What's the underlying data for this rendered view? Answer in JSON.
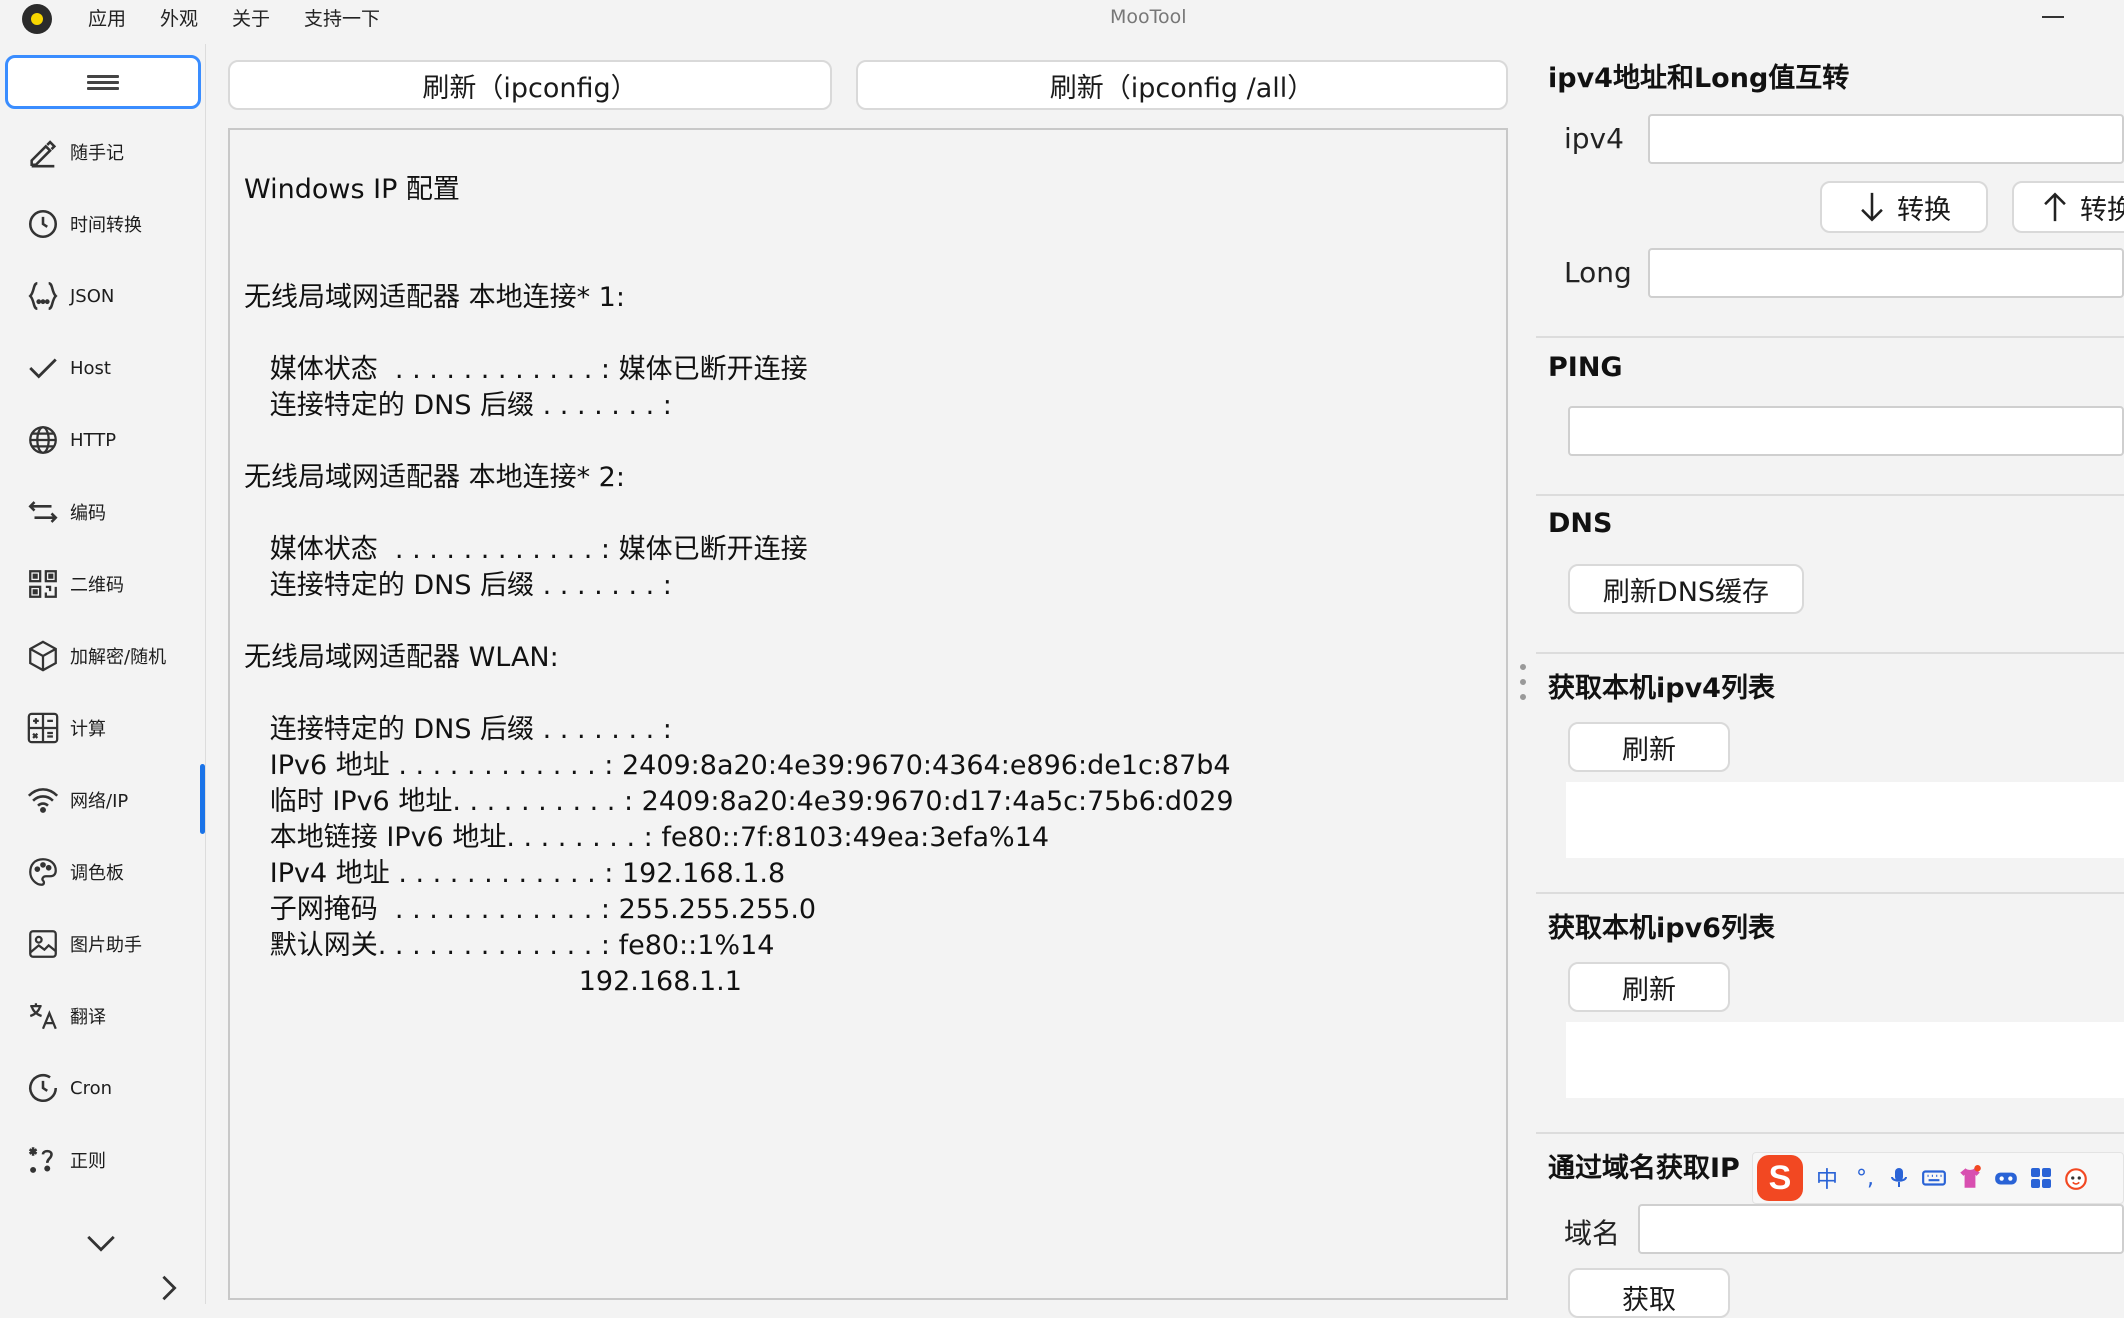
{
  "window": {
    "title": "MooTool",
    "menu": [
      "应用",
      "外观",
      "关于",
      "支持一下"
    ]
  },
  "sidebar": {
    "items": [
      {
        "label": "随手记",
        "icon": "pencil-icon"
      },
      {
        "label": "时间转换",
        "icon": "clock-icon"
      },
      {
        "label": "JSON",
        "icon": "braces-icon"
      },
      {
        "label": "Host",
        "icon": "checkmark-icon"
      },
      {
        "label": "HTTP",
        "icon": "globe-icon"
      },
      {
        "label": "编码",
        "icon": "swap-arrows-icon"
      },
      {
        "label": "二维码",
        "icon": "qrcode-icon"
      },
      {
        "label": "加解密/随机",
        "icon": "cube-icon"
      },
      {
        "label": "计算",
        "icon": "calculator-icon"
      },
      {
        "label": "网络/IP",
        "icon": "wifi-icon"
      },
      {
        "label": "调色板",
        "icon": "palette-icon"
      },
      {
        "label": "图片助手",
        "icon": "image-icon"
      },
      {
        "label": "翻译",
        "icon": "translate-icon"
      },
      {
        "label": "Cron",
        "icon": "cron-clock-icon"
      },
      {
        "label": "正则",
        "icon": "regex-icon"
      }
    ],
    "active": "网络/IP"
  },
  "toolbar": {
    "refresh_ipconfig": "刷新（ipconfig）",
    "refresh_ipconfig_all": "刷新（ipconfig /all）"
  },
  "output": {
    "text": "Windows IP 配置\n\n\n无线局域网适配器 本地连接* 1:\n\n   媒体状态  . . . . . . . . . . . . : 媒体已断开连接\n   连接特定的 DNS 后缀 . . . . . . . :\n\n无线局域网适配器 本地连接* 2:\n\n   媒体状态  . . . . . . . . . . . . : 媒体已断开连接\n   连接特定的 DNS 后缀 . . . . . . . :\n\n无线局域网适配器 WLAN:\n\n   连接特定的 DNS 后缀 . . . . . . . :\n   IPv6 地址 . . . . . . . . . . . . : 2409:8a20:4e39:9670:4364:e896:de1c:87b4\n   临时 IPv6 地址. . . . . . . . . . : 2409:8a20:4e39:9670:d17:4a5c:75b6:d029\n   本地链接 IPv6 地址. . . . . . . . : fe80::7f:8103:49ea:3efa%14\n   IPv4 地址 . . . . . . . . . . . . : 192.168.1.8\n   子网掩码  . . . . . . . . . . . . : 255.255.255.0\n   默认网关. . . . . . . . . . . . . : fe80::1%14\n                                       192.168.1.1"
  },
  "ipv4_long": {
    "title": "ipv4地址和Long值互转",
    "ipv4_label": "ipv4",
    "ipv4_value": "",
    "convert_down": "转换",
    "convert_up": "转换",
    "long_label": "Long",
    "long_value": ""
  },
  "ping": {
    "title": "PING",
    "value": ""
  },
  "dns": {
    "title": "DNS",
    "flush_button": "刷新DNS缓存"
  },
  "ipv4_list": {
    "title": "获取本机ipv4列表",
    "refresh_button": "刷新"
  },
  "ipv6_list": {
    "title": "获取本机ipv6列表",
    "refresh_button": "刷新"
  },
  "domain_ip": {
    "title": "通过域名获取IP",
    "domain_label": "域名",
    "domain_value": "",
    "get_button": "获取"
  },
  "ime": {
    "logo": "S",
    "mode": "中",
    "punct": "°,"
  }
}
